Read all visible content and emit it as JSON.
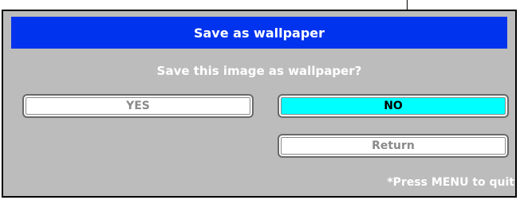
{
  "dialog": {
    "title": "Save as wallpaper",
    "question": "Save this image as wallpaper?",
    "buttons": {
      "yes": "YES",
      "no": "NO",
      "return": "Return"
    },
    "selected_button": "no",
    "hint": "*Press MENU to quit"
  },
  "colors": {
    "title_bar": "#0033ee",
    "dialog_background": "#bcbcbc",
    "selected_button": "#00ffff",
    "unselected_button": "#ffffff",
    "unselected_text": "#8a8a8a"
  }
}
